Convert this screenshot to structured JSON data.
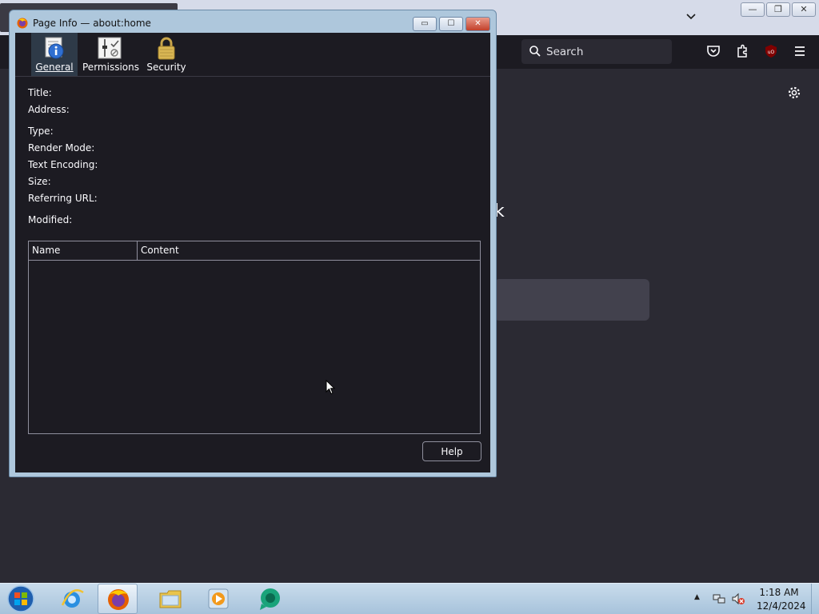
{
  "dialog": {
    "title": "Page Info — about:home",
    "tabs": [
      {
        "label": "General",
        "icon": "info-icon",
        "selected": true
      },
      {
        "label": "Permissions",
        "icon": "permissions-icon",
        "selected": false
      },
      {
        "label": "Security",
        "icon": "lock-icon",
        "selected": false
      }
    ],
    "fields": {
      "title": "Title:",
      "address": "Address:",
      "type": "Type:",
      "render_mode": "Render Mode:",
      "text_encoding": "Text Encoding:",
      "size": "Size:",
      "referring_url": "Referring URL:",
      "modified": "Modified:"
    },
    "table": {
      "columns": [
        "Name",
        "Content"
      ],
      "rows": []
    },
    "help_label": "Help",
    "controls": {
      "minimize": "▭",
      "maximize": "☐",
      "close": "✕"
    }
  },
  "browser": {
    "search_placeholder": "Search",
    "toolbar_icons": [
      "pocket-icon",
      "extensions-icon",
      "ublock-icon",
      "menu-icon"
    ],
    "settings_icon": "gear-icon",
    "tab_list_icon": "chevron-down-icon",
    "window_controls": {
      "minimize": "—",
      "restore": "❐",
      "close": "✕"
    },
    "fragment_glyph": "k"
  },
  "taskbar": {
    "apps": [
      "start-orb-icon",
      "internet-explorer-icon",
      "firefox-icon",
      "file-explorer-icon",
      "media-player-icon",
      "chat-app-icon"
    ],
    "tray_up": "▲",
    "clock_time": "1:18 AM",
    "clock_date": "12/4/2024"
  },
  "colors": {
    "dark_bg": "#1c1b22",
    "page_bg": "#2b2a33",
    "dialog_frame": "#aec7dc",
    "taskbar": "#b8cfe3"
  }
}
